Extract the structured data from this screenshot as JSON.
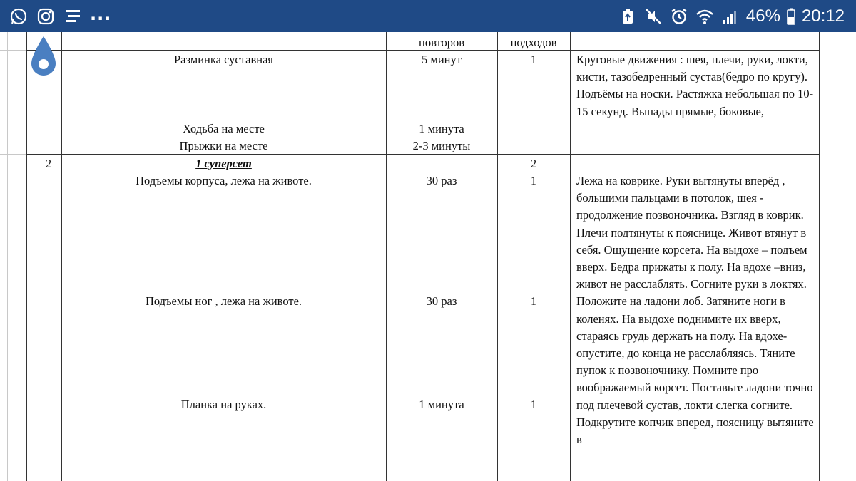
{
  "statusbar": {
    "icons_left": [
      "whatsapp-icon",
      "instagram-icon",
      "notes-icon"
    ],
    "overflow": "...",
    "battery_percent": "46%",
    "time": "20:12",
    "color": "#1f4a86"
  },
  "table": {
    "headers": {
      "reps": "повторов",
      "sets": "подходов"
    },
    "section1": {
      "rows": [
        {
          "name": "Разминка суставная",
          "reps": "5 минут",
          "sets": "1"
        },
        {
          "name": "Ходьба на месте",
          "reps": "1 минута",
          "sets": ""
        },
        {
          "name": "Прыжки на месте",
          "reps": "2-3 минуты",
          "sets": ""
        }
      ],
      "description": "Круговые движения : шея, плечи, руки, локти, кисти, тазобедренный сустав(бедро по кругу). Подъёмы на носки. Растяжка небольшая по 10-15 секунд. Выпады прямые, боковые,"
    },
    "section2": {
      "number": "2",
      "superset_title": "1 суперсет",
      "superset_sets": "2",
      "rows": [
        {
          "name": "Подъемы корпуса, лежа на животе.",
          "reps": "30 раз",
          "sets": "1"
        },
        {
          "name": "Подъемы ног , лежа на животе.",
          "reps": "30 раз",
          "sets": "1"
        },
        {
          "name": "Планка на руках.",
          "reps": "1 минута",
          "sets": "1"
        }
      ],
      "description": "Лежа на коврике. Руки вытянуты вперёд , большими пальцами в потолок, шея - продолжение позвоночника. Взгляд в коврик. Плечи подтянуты к пояснице. Живот втянут в себя. Ощущение корсета. На выдохе – подъем вверх. Бедра прижаты к полу. На вдохе –вниз, живот не расслаблять. Согните руки в локтях. Положите на ладони лоб. Затяните ноги в коленях. На выдохе поднимите их вверх, стараясь грудь держать на полу. На вдохе- опустите, до конца не расслабляясь. Тяните пупок к позвоночнику. Помните про воображаемый корсет. Поставьте ладони точно под плечевой сустав, локти слегка согните. Подкрутите копчик вперед, поясницу вытяните в"
    }
  }
}
